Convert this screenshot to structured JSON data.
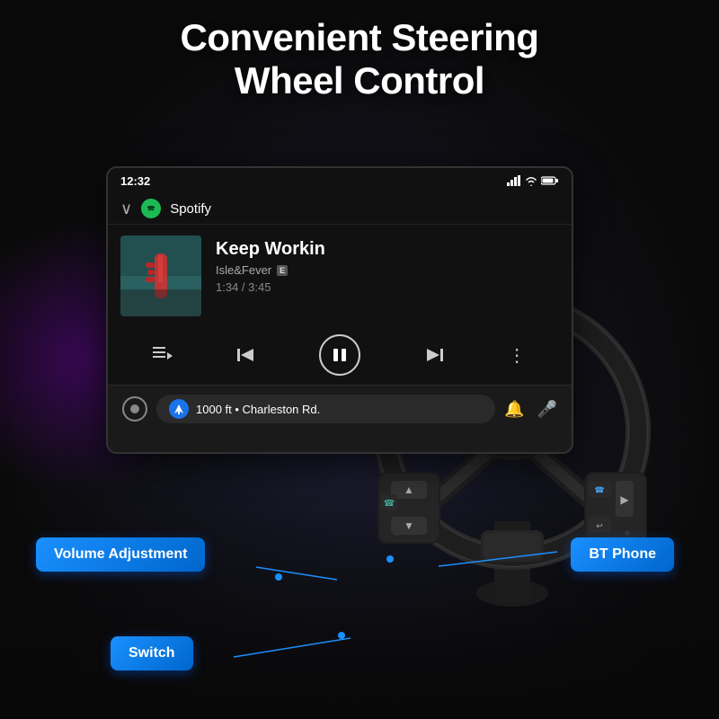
{
  "page": {
    "title": "Convenient Steering Wheel Control",
    "title_line1": "Convenient Steering",
    "title_line2": "Wheel Control"
  },
  "screen": {
    "status_bar": {
      "time": "12:32",
      "icons": [
        "signal",
        "wifi",
        "battery"
      ]
    },
    "app": {
      "name": "Spotify",
      "logo_letter": "S"
    },
    "track": {
      "name": "Keep Workin",
      "artist": "Isle&Fever",
      "explicit": "E",
      "current_time": "1:34",
      "total_time": "3:45",
      "time_display": "1:34 / 3:45"
    },
    "controls": {
      "queue": "≡♪",
      "prev": "⏮",
      "play_pause": "⏸",
      "next": "⏭",
      "more": "⋮"
    },
    "navigation": {
      "direction": "↱",
      "distance": "1000 ft",
      "street": "Charleston Rd.",
      "nav_text": "1000 ft • Charleston Rd."
    }
  },
  "labels": {
    "volume": "Volume Adjustment",
    "bt_phone": "BT Phone",
    "switch": "Switch"
  }
}
